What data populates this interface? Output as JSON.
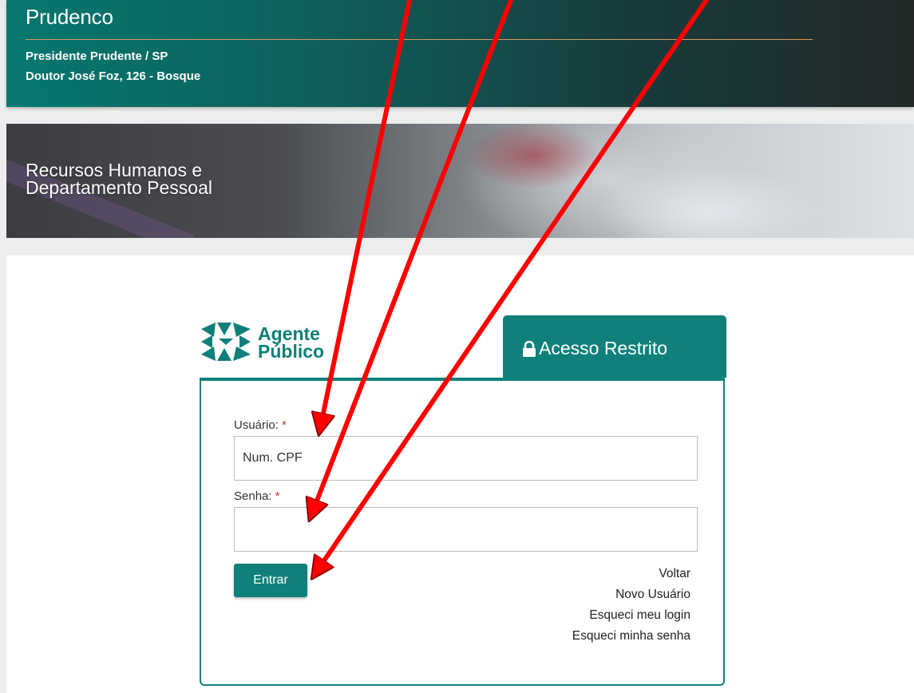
{
  "header": {
    "org_name": "Prudenco",
    "city": "Presidente Prudente / SP",
    "address": "Doutor José Foz, 126 - Bosque"
  },
  "banner": {
    "title_line1": "Recursos Humanos e",
    "title_line2": "Departamento Pessoal"
  },
  "logo": {
    "line1": "Agente",
    "line2": "Público"
  },
  "tab": {
    "label": "Acesso Restrito",
    "icon": "lock-icon"
  },
  "form": {
    "user_label": "Usuário:",
    "user_placeholder": "Num. CPF",
    "password_label": "Senha:",
    "required_mark": "*",
    "submit_label": "Entrar"
  },
  "links": {
    "back": "Voltar",
    "new_user": "Novo Usuário",
    "forgot_login": "Esqueci meu login",
    "forgot_password": "Esqueci minha senha"
  },
  "colors": {
    "brand_teal": "#0f807a",
    "required": "#c0392b",
    "arrow_red": "#ff0000"
  }
}
